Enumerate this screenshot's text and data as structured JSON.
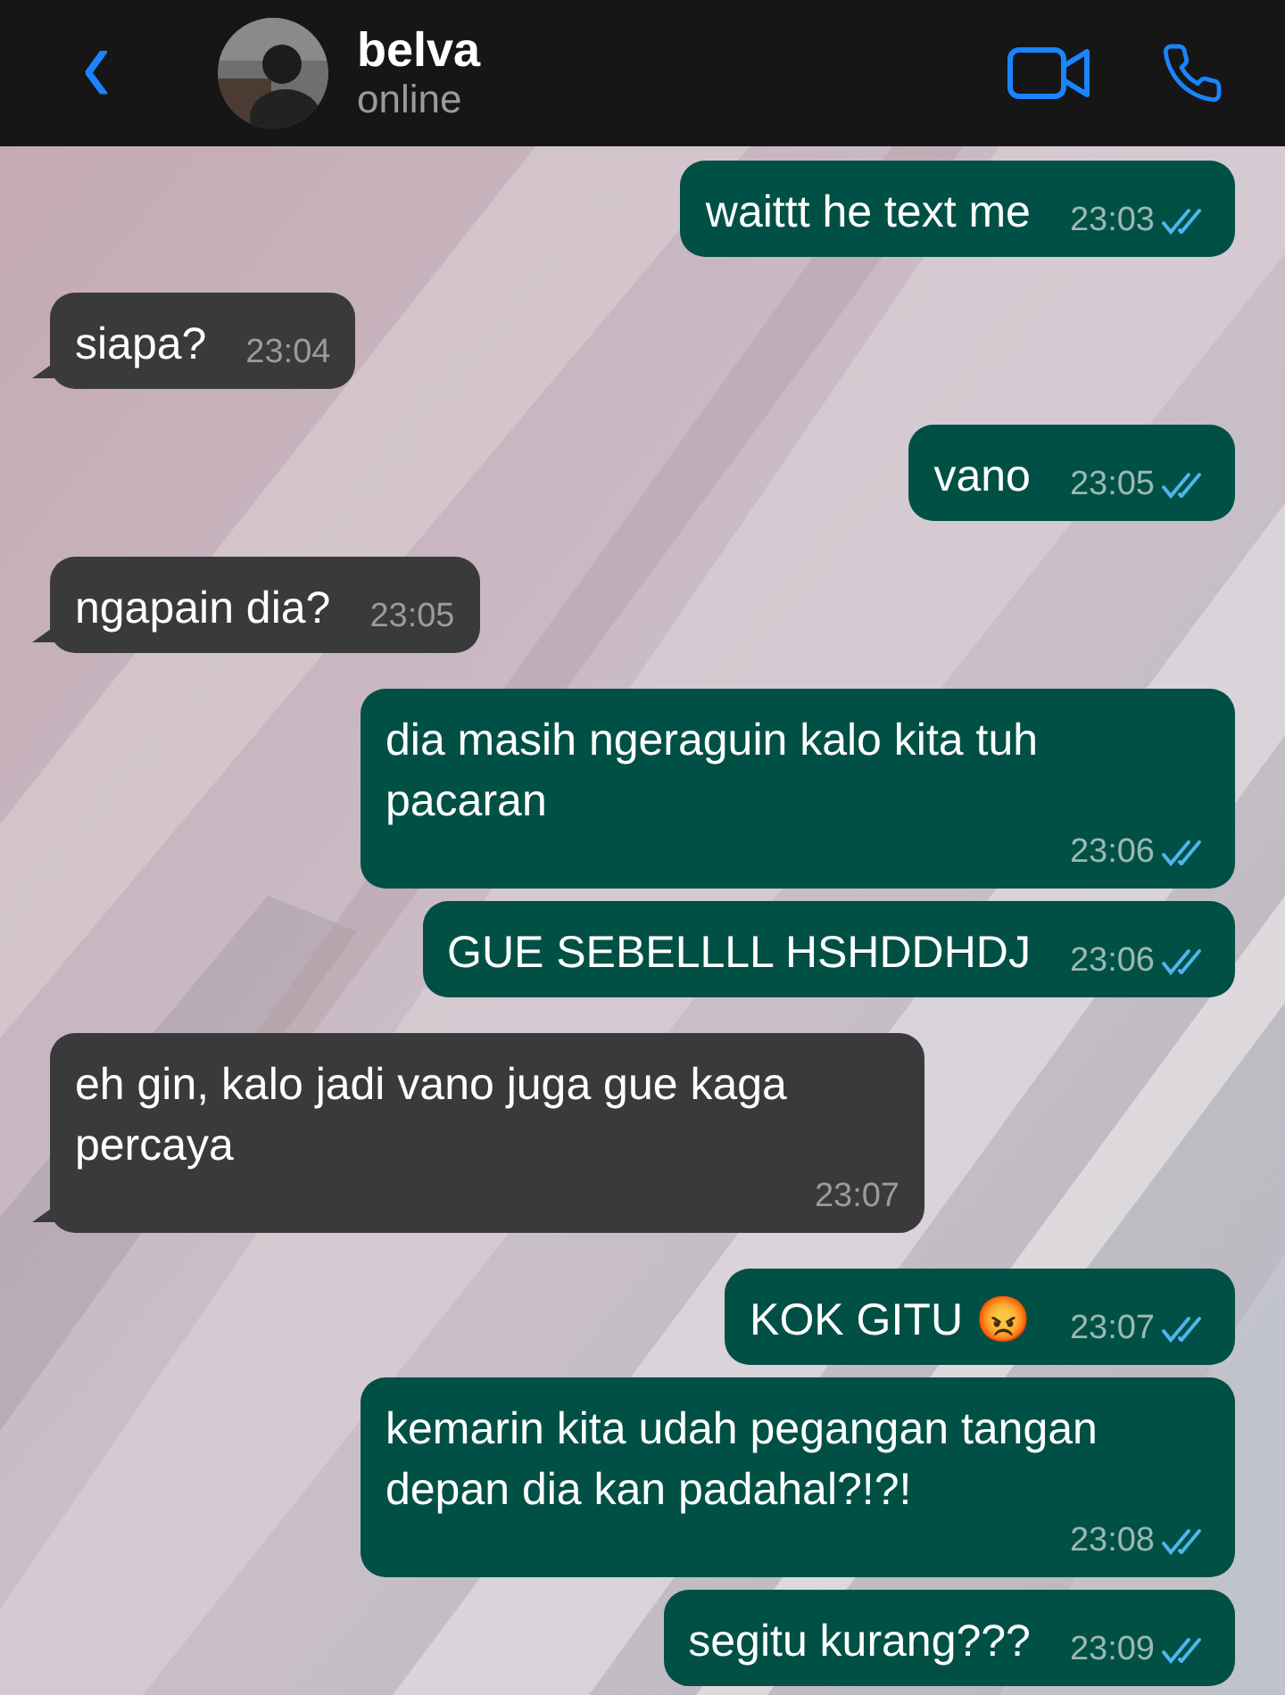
{
  "header": {
    "back": "‹",
    "name": "belva",
    "status": "online"
  },
  "messages": [
    {
      "kind": "outgoing",
      "text": "waittt he text me",
      "time": "23:03",
      "read": true
    },
    {
      "kind": "incoming",
      "text": "siapa?",
      "time": "23:04"
    },
    {
      "kind": "outgoing",
      "text": "vano",
      "time": "23:05",
      "read": true
    },
    {
      "kind": "incoming",
      "text": "ngapain dia?",
      "time": "23:05"
    },
    {
      "kind": "outgoing",
      "text": "dia masih ngeraguin kalo kita tuh pacaran",
      "time": "23:06",
      "read": true
    },
    {
      "kind": "outgoing",
      "text": "GUE SEBELLLL HSHDDHDJ",
      "time": "23:06",
      "read": true,
      "grouped": true
    },
    {
      "kind": "incoming",
      "text": "eh gin, kalo jadi vano juga gue kaga percaya",
      "time": "23:07"
    },
    {
      "kind": "outgoing",
      "text": "KOK GITU 😡",
      "time": "23:07",
      "read": true
    },
    {
      "kind": "outgoing",
      "text": "kemarin kita udah pegangan tangan depan dia kan padahal?!?!",
      "time": "23:08",
      "read": true,
      "grouped": true
    },
    {
      "kind": "outgoing",
      "text": "segitu kurang???",
      "time": "23:09",
      "read": true,
      "grouped": true
    }
  ]
}
